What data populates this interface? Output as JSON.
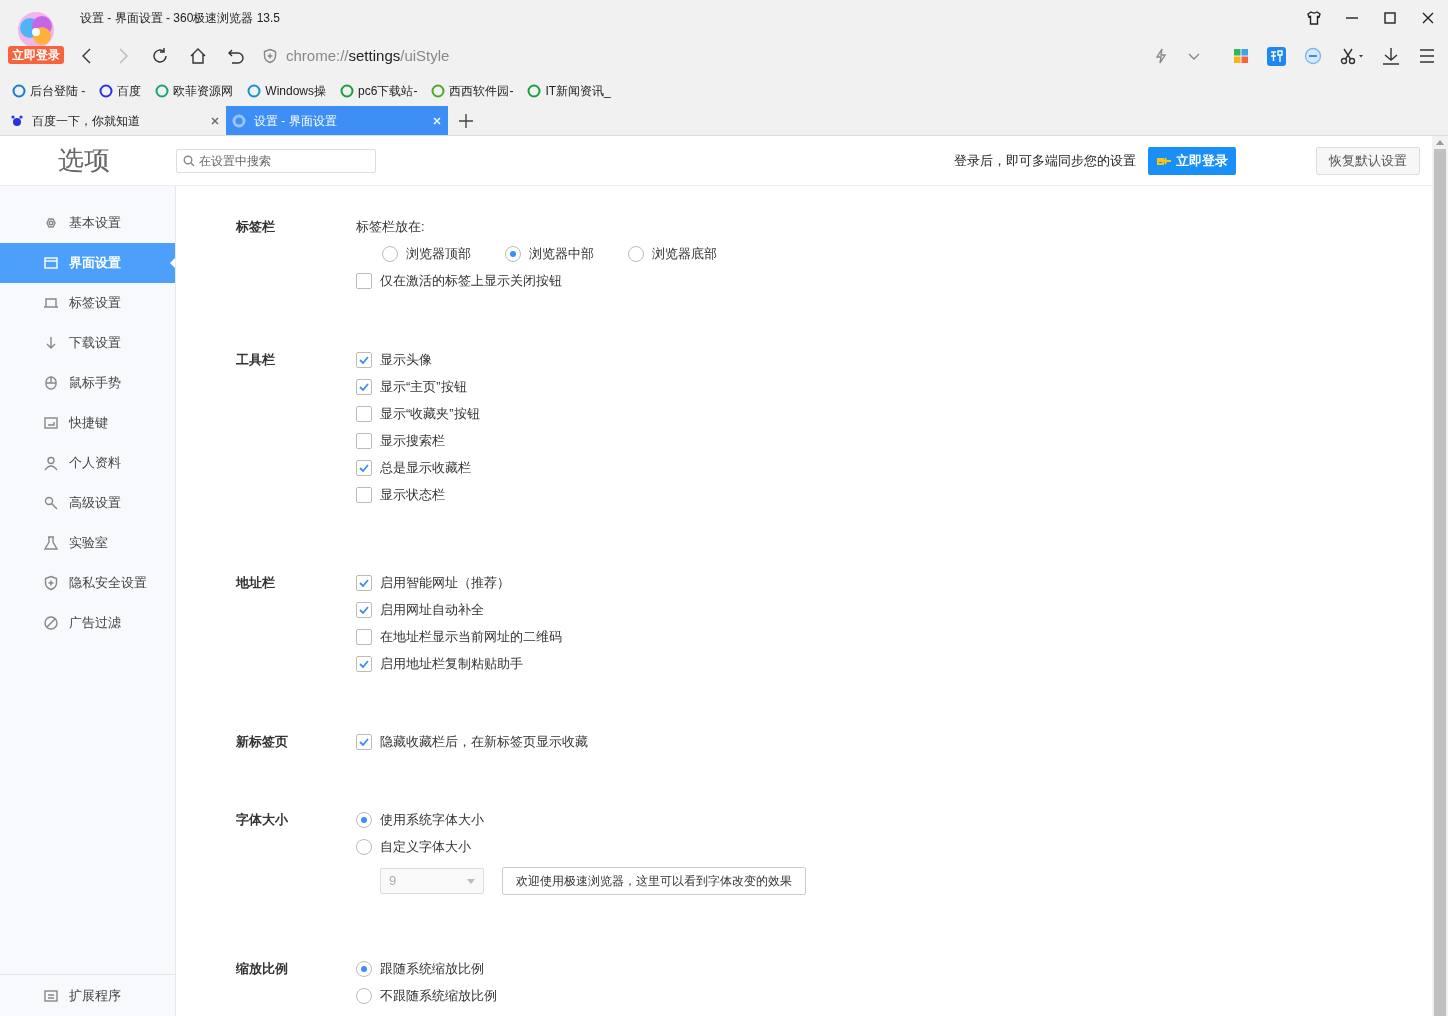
{
  "window": {
    "title": "设置 - 界面设置 - 360极速浏览器 13.5",
    "login_badge": "立即登录"
  },
  "address_bar": {
    "scheme": "chrome://",
    "host": "settings",
    "path": "/uiStyle"
  },
  "bookmarks": [
    "后台登陆 -",
    "百度",
    "欧菲资源网",
    "Windows操",
    "pc6下载站-",
    "西西软件园-",
    "IT新闻资讯_"
  ],
  "tabs": [
    {
      "label": "百度一下，你就知道",
      "selected": false
    },
    {
      "label": "设置 - 界面设置",
      "selected": true
    }
  ],
  "header": {
    "title": "选项",
    "search_placeholder": "在设置中搜索",
    "sync_prompt": "登录后，即可多端同步您的设置",
    "login_button": "立即登录",
    "reset_button": "恢复默认设置"
  },
  "sidebar": {
    "items": [
      {
        "label": "基本设置",
        "selected": false
      },
      {
        "label": "界面设置",
        "selected": true
      },
      {
        "label": "标签设置",
        "selected": false
      },
      {
        "label": "下载设置",
        "selected": false
      },
      {
        "label": "鼠标手势",
        "selected": false
      },
      {
        "label": "快捷键",
        "selected": false
      },
      {
        "label": "个人资料",
        "selected": false
      },
      {
        "label": "高级设置",
        "selected": false
      },
      {
        "label": "实验室",
        "selected": false
      },
      {
        "label": "隐私安全设置",
        "selected": false
      },
      {
        "label": "广告过滤",
        "selected": false
      }
    ],
    "footer": "扩展程序"
  },
  "sections": [
    {
      "heading": "标签栏",
      "rows": [
        {
          "kind": "label",
          "text": "标签栏放在:"
        },
        {
          "kind": "radio_group",
          "options": [
            {
              "label": "浏览器顶部",
              "selected": false
            },
            {
              "label": "浏览器中部",
              "selected": true
            },
            {
              "label": "浏览器底部",
              "selected": false
            }
          ]
        },
        {
          "kind": "checkbox",
          "label": "仅在激活的标签上显示关闭按钮",
          "checked": false
        }
      ]
    },
    {
      "heading": "工具栏",
      "rows": [
        {
          "kind": "checkbox",
          "label": "显示头像",
          "checked": true
        },
        {
          "kind": "checkbox",
          "label": "显示“主页”按钮",
          "checked": true
        },
        {
          "kind": "checkbox",
          "label": "显示“收藏夹”按钮",
          "checked": false
        },
        {
          "kind": "checkbox",
          "label": "显示搜索栏",
          "checked": false
        },
        {
          "kind": "checkbox",
          "label": "总是显示收藏栏",
          "checked": true
        },
        {
          "kind": "checkbox",
          "label": "显示状态栏",
          "checked": false
        }
      ]
    },
    {
      "heading": "地址栏",
      "rows": [
        {
          "kind": "checkbox",
          "label": "启用智能网址（推荐）",
          "checked": true
        },
        {
          "kind": "checkbox",
          "label": "启用网址自动补全",
          "checked": true
        },
        {
          "kind": "checkbox",
          "label": "在地址栏显示当前网址的二维码",
          "checked": false
        },
        {
          "kind": "checkbox",
          "label": "启用地址栏复制粘贴助手",
          "checked": true
        }
      ]
    },
    {
      "heading": "新标签页",
      "rows": [
        {
          "kind": "checkbox",
          "label": "隐藏收藏栏后，在新标签页显示收藏",
          "checked": true
        }
      ]
    },
    {
      "heading": "字体大小",
      "rows": [
        {
          "kind": "radio",
          "label": "使用系统字体大小",
          "selected": true
        },
        {
          "kind": "radio",
          "label": "自定义字体大小",
          "selected": false
        },
        {
          "kind": "font_preview",
          "size": "9",
          "disabled": true,
          "preview": "欢迎使用极速浏览器，这里可以看到字体改变的效果"
        }
      ]
    },
    {
      "heading": "缩放比例",
      "rows": [
        {
          "kind": "radio",
          "label": "跟随系统缩放比例",
          "selected": true
        },
        {
          "kind": "radio",
          "label": "不跟随系统缩放比例",
          "selected": false
        }
      ]
    }
  ]
}
